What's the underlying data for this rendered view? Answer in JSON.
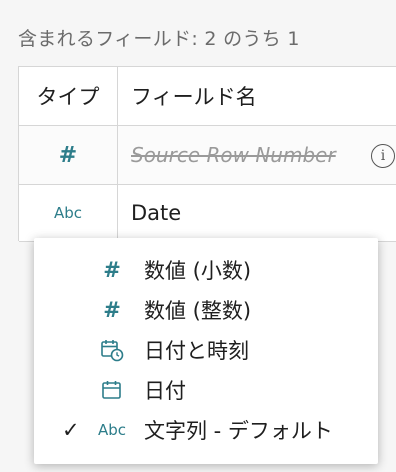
{
  "summary": {
    "text": "含まれるフィールド: 2 のうち 1"
  },
  "table": {
    "headers": {
      "type": "タイプ",
      "name": "フィールド名"
    },
    "rows": [
      {
        "type_glyph": "#",
        "type_icon": "number-icon",
        "name": "Source Row Number",
        "excluded": true
      },
      {
        "type_glyph": "Abc",
        "type_icon": "string-icon",
        "name": "Date",
        "excluded": false
      }
    ]
  },
  "menu": {
    "items": [
      {
        "glyph": "#",
        "icon": "number-icon",
        "label": "数値 (小数)",
        "checked": false
      },
      {
        "glyph": "#",
        "icon": "number-icon",
        "label": "数値 (整数)",
        "checked": false
      },
      {
        "glyph": "",
        "icon": "datetime-icon",
        "label": "日付と時刻",
        "checked": false
      },
      {
        "glyph": "",
        "icon": "date-icon",
        "label": "日付",
        "checked": false
      },
      {
        "glyph": "Abc",
        "icon": "string-icon",
        "label": "文字列 - デフォルト",
        "checked": true
      }
    ],
    "check_glyph": "✓"
  },
  "colors": {
    "type_icon": "#2d7d8a",
    "text": "#1f1f1f",
    "muted": "#6b6b6b",
    "border": "#d6d6d6"
  }
}
